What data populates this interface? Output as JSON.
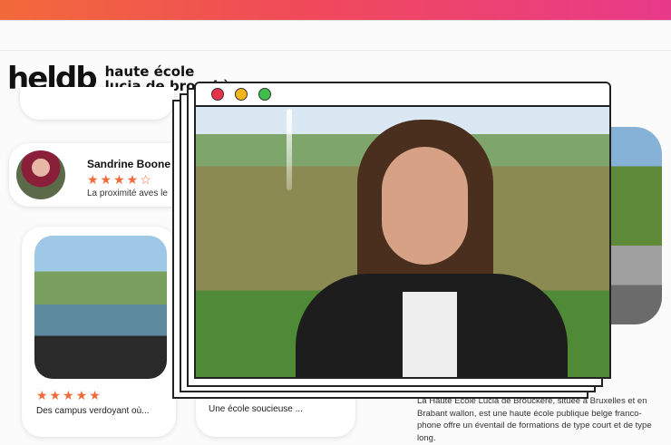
{
  "brand": {
    "mark": "heldb",
    "line1": "haute école",
    "line2": "lucia de brouckère",
    "dot_colors": [
      "#f26a3a",
      "#e83a8a",
      "#7a3ac8"
    ]
  },
  "reviews": [
    {
      "name": "Sandrine Boone",
      "stars": "★★★★☆",
      "rating": 3.5,
      "text": "La proximité aves le"
    }
  ],
  "photo_card": {
    "stars": "★★★★★",
    "caption": "Des campus verdoyant où..."
  },
  "mid_card": {
    "caption": "Une école soucieuse ..."
  },
  "description": "La Haute École Lucia de Brouckère, située à Bruxelles et en Brabant wallon, est une haute école publique belge franco-phone offre un éventail de formations de type court et de type long.",
  "window": {
    "controls": [
      "close",
      "minimize",
      "maximize"
    ]
  },
  "colors": {
    "accent": "#f26a3a",
    "topbar_end": "#e83a8a"
  }
}
